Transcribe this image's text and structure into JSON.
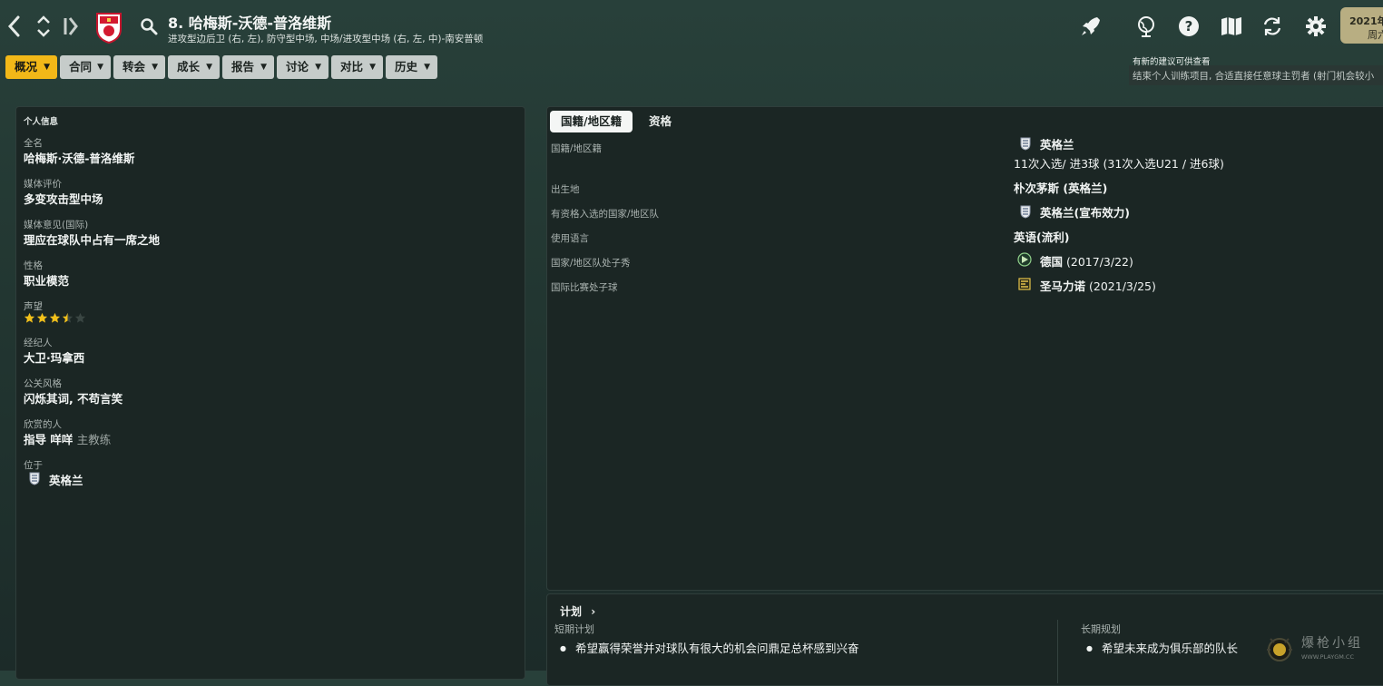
{
  "header": {
    "title": "8. 哈梅斯-沃德-普洛维斯",
    "subtitle": "进攻型边后卫 (右, 左), 防守型中场, 中场/进攻型中场 (右, 左, 中)-南安普顿",
    "date_line1": "2021年",
    "date_line2": "周六",
    "notice_title": "有新的建议可供查看",
    "notice_text": "结束个人训练项目, 合适直接任意球主罚者 (射门机会较小"
  },
  "tabs": [
    {
      "label": "概况",
      "active": true
    },
    {
      "label": "合同"
    },
    {
      "label": "转会"
    },
    {
      "label": "成长"
    },
    {
      "label": "报告"
    },
    {
      "label": "讨论"
    },
    {
      "label": "对比"
    },
    {
      "label": "历史"
    }
  ],
  "personal": {
    "section_title": "个人信息",
    "full_name_label": "全名",
    "full_name": "哈梅斯·沃德-普洛维斯",
    "media_desc_label": "媒体评价",
    "media_desc": "多变攻击型中场",
    "media_opinion_label": "媒体意见(国际)",
    "media_opinion": "理应在球队中占有一席之地",
    "personality_label": "性格",
    "personality": "职业模范",
    "reputation_label": "声望",
    "reputation_stars": 3.5,
    "agent_label": "经纪人",
    "agent": "大卫·玛拿西",
    "pr_style_label": "公关风格",
    "pr_style": "闪烁其词, 不苟言笑",
    "favored_label": "欣赏的人",
    "favored_name": "指导 咩咩",
    "favored_role": "主教练",
    "based_label": "位于",
    "based": "英格兰"
  },
  "nationality": {
    "tab_active": "国籍/地区籍",
    "tab_other": "资格",
    "rows": {
      "nat_label": "国籍/地区籍",
      "nat_value": "英格兰",
      "caps": "11次入选/ 进3球 (31次入选U21 / 进6球)",
      "birth_label": "出生地",
      "birth_value": "朴次茅斯 (英格兰)",
      "eligible_label": "有资格入选的国家/地区队",
      "eligible_value": "英格兰(宣布效力)",
      "language_label": "使用语言",
      "language_value": "英语(流利)",
      "debut_label": "国家/地区队处子秀",
      "debut_team": "德国",
      "debut_date": "(2017/3/22)",
      "goal_label": "国际比赛处子球",
      "goal_team": "圣马力诺",
      "goal_date": "(2021/3/25)"
    }
  },
  "plans": {
    "title": "计划",
    "short_label": "短期计划",
    "short_item": "希望赢得荣誉并对球队有很大的机会问鼎足总杯感到兴奋",
    "long_label": "长期规划",
    "long_item": "希望未来成为俱乐部的队长"
  },
  "watermark": {
    "text_cn": "爆枪小组",
    "text_url": "WWW.PLAYGM.CC"
  },
  "colors": {
    "accent": "#f2b818",
    "panel": "#1b2624",
    "star": "#f2c01a"
  }
}
